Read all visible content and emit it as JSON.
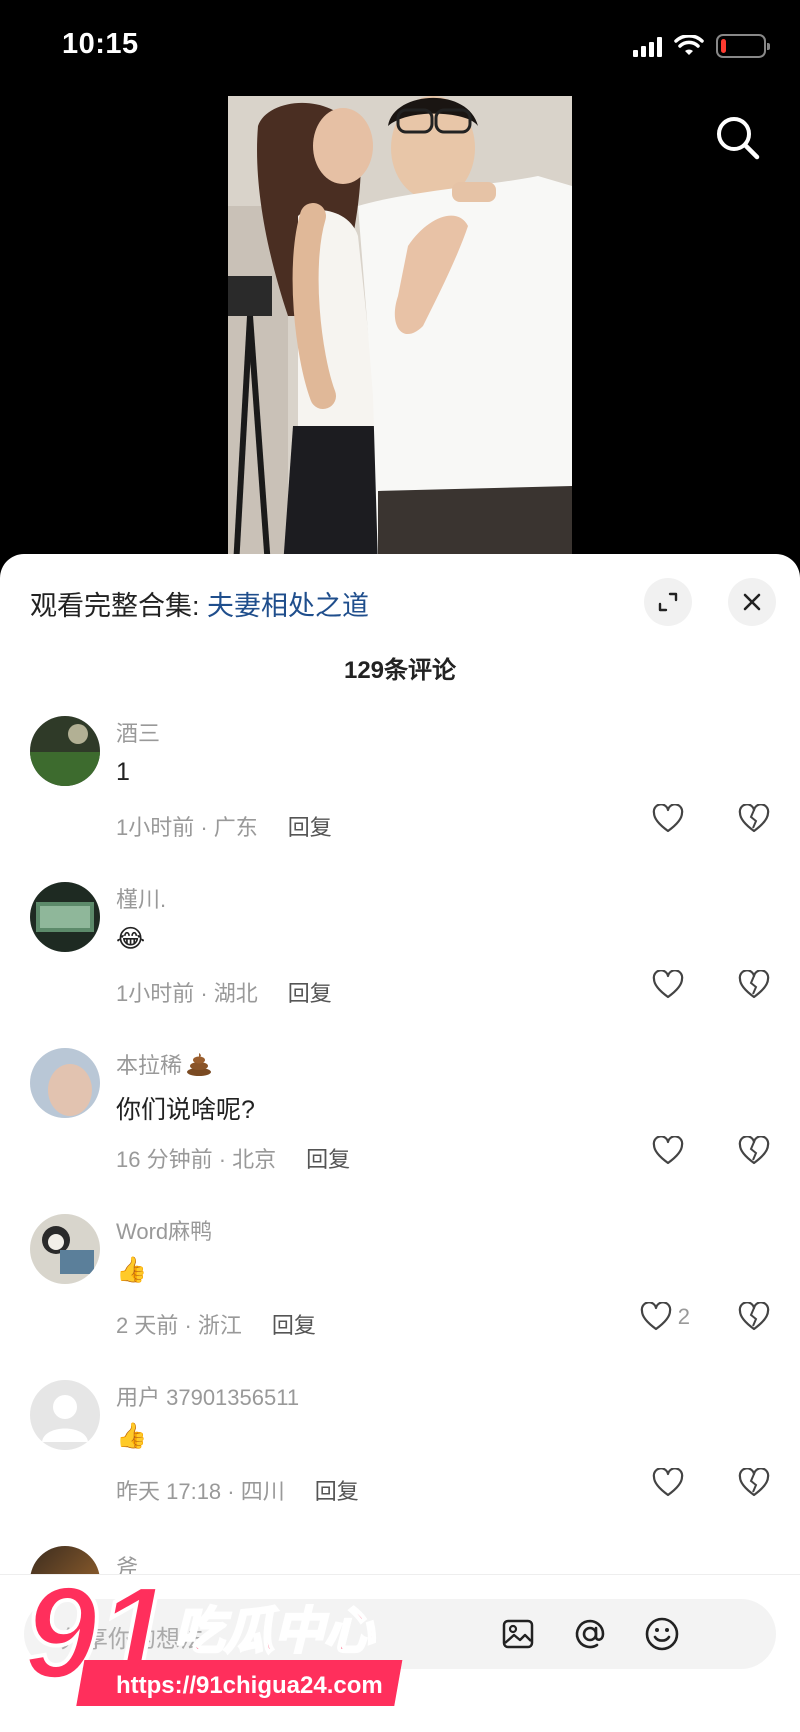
{
  "status_bar": {
    "time": "10:15",
    "battery_level": 0.12
  },
  "collection": {
    "prefix": "观看完整合集: ",
    "title": "夫妻相处之道"
  },
  "comments_count": "129条评论",
  "comments": [
    {
      "user": "酒三",
      "text": "1",
      "time": "1小时前 · 广东",
      "reply": "回复",
      "likes": ""
    },
    {
      "user": "槿川.",
      "text": "😂",
      "time": "1小时前 · 湖北",
      "reply": "回复",
      "likes": ""
    },
    {
      "user": "本拉稀",
      "text": "你们说啥呢?",
      "time": "16 分钟前 · 北京",
      "reply": "回复",
      "likes": ""
    },
    {
      "user": "Word麻鸭",
      "text": "👍",
      "time": "2 天前 · 浙江",
      "reply": "回复",
      "likes": "2"
    },
    {
      "user": "用户 37901356511",
      "text": "👍",
      "time": "昨天 17:18 · 四川",
      "reply": "回复",
      "likes": ""
    }
  ],
  "partial_comment": {
    "user": "斧"
  },
  "input": {
    "placeholder": "分享你的想法"
  },
  "watermark": {
    "brand": "91吃瓜中心",
    "url": "https://91chigua24.com"
  },
  "icons": {
    "search": "search-icon",
    "expand": "expand-icon",
    "close": "close-icon",
    "like": "heart-icon",
    "dislike": "broken-heart-icon",
    "image": "image-icon",
    "at": "at-icon",
    "emoji": "emoji-icon"
  }
}
